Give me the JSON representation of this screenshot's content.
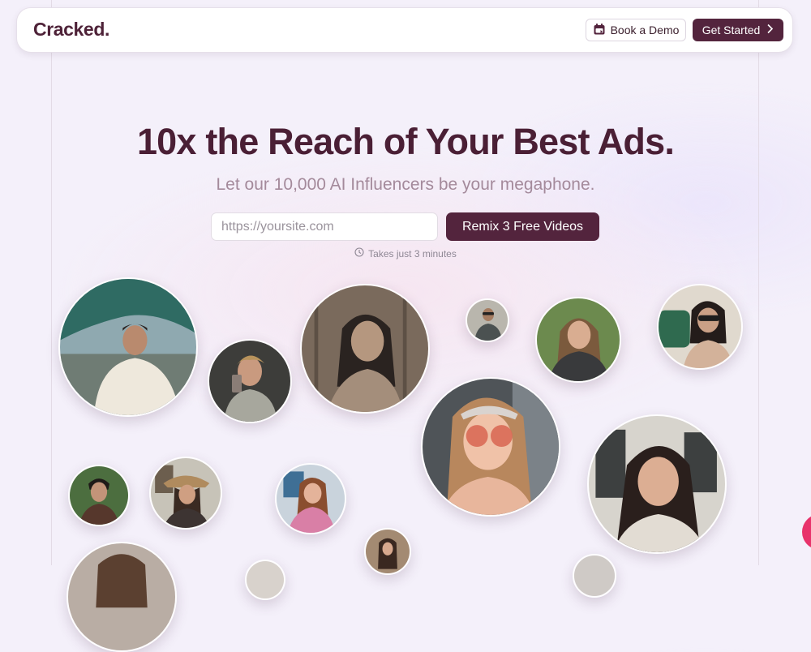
{
  "nav": {
    "logo": "Cracked.",
    "demo_label": "Book a Demo",
    "start_label": "Get Started"
  },
  "hero": {
    "headline": "10x the Reach of Your Best Ads.",
    "subhead": "Let our 10,000 AI Influencers be your megaphone.",
    "url_placeholder": "https://yoursite.com",
    "cta_label": "Remix 3 Free Videos",
    "duration_note": "Takes just 3 minutes"
  },
  "colors": {
    "brand": "#53243d",
    "headline": "#4a1f35",
    "subhead": "#a48a9b",
    "chat_button": "#e8336b"
  },
  "icons": {
    "demo_button": "calendar-icon",
    "start_button": "chevron-right-icon",
    "duration_note": "clock-icon"
  }
}
